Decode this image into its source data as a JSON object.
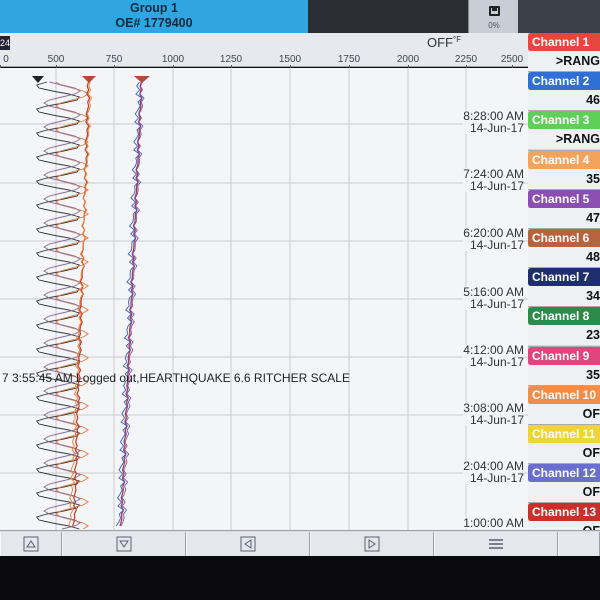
{
  "header": {
    "group_title": "Group 1",
    "oe_number": "OE# 1779400",
    "save_percent": "0%"
  },
  "scale": {
    "channel_tag": "24",
    "off_text": "OFF",
    "unit": "°F",
    "ticks": [
      "0",
      "500",
      "750",
      "1000",
      "1250",
      "1500",
      "1750",
      "2000",
      "2250",
      "2500"
    ]
  },
  "chart": {
    "times": [
      {
        "time": "8:28:00 AM",
        "date": "14-Jun-17"
      },
      {
        "time": "7:24:00 AM",
        "date": "14-Jun-17"
      },
      {
        "time": "6:20:00 AM",
        "date": "14-Jun-17"
      },
      {
        "time": "5:16:00 AM",
        "date": "14-Jun-17"
      },
      {
        "time": "4:12:00 AM",
        "date": "14-Jun-17"
      },
      {
        "time": "3:08:00 AM",
        "date": "14-Jun-17"
      },
      {
        "time": "2:04:00 AM",
        "date": "14-Jun-17"
      },
      {
        "time": "1:00:00 AM",
        "date": ""
      }
    ],
    "annotation": "7 3:55:45 AM Logged out,HEARTHQUAKE   6.6  RITCHER SCALE"
  },
  "channels": [
    {
      "name": "Channel 1",
      "value": ">RANG",
      "color": "#e8453c"
    },
    {
      "name": "Channel 2",
      "value": "46",
      "color": "#2f6fd6"
    },
    {
      "name": "Channel 3",
      "value": ">RANG",
      "color": "#5ed05a"
    },
    {
      "name": "Channel 4",
      "value": "35",
      "color": "#f2a35c"
    },
    {
      "name": "Channel 5",
      "value": "47",
      "color": "#8a4fb0"
    },
    {
      "name": "Channel 6",
      "value": "48",
      "color": "#b8633f"
    },
    {
      "name": "Channel 7",
      "value": "34",
      "color": "#1f2f6e"
    },
    {
      "name": "Channel 8",
      "value": "23",
      "color": "#2e8a4a"
    },
    {
      "name": "Channel 9",
      "value": "35",
      "color": "#e0457c"
    },
    {
      "name": "Channel 10",
      "value": "OF",
      "color": "#f28c4a"
    },
    {
      "name": "Channel 11",
      "value": "OF",
      "color": "#f0d23a"
    },
    {
      "name": "Channel 12",
      "value": "OF",
      "color": "#6a6fcf"
    },
    {
      "name": "Channel 13",
      "value": "OF",
      "color": "#c9302c"
    }
  ],
  "nav": {
    "buttons": [
      "up-arrow-icon",
      "down-arrow-icon",
      "left-arrow-icon",
      "right-arrow-icon",
      "menu-icon"
    ]
  }
}
